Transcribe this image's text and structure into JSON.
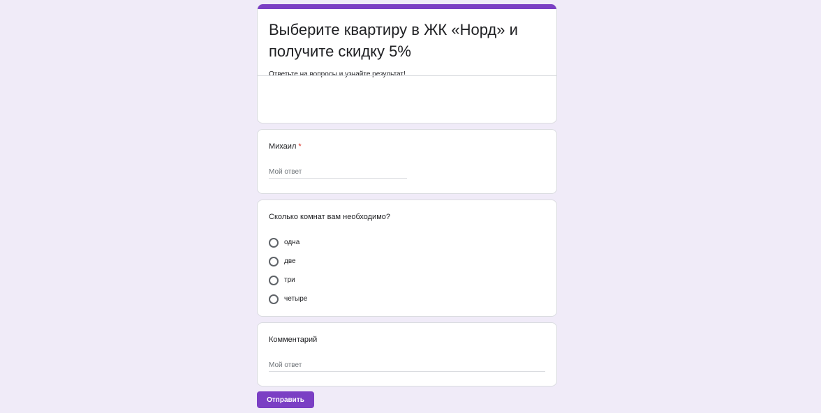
{
  "colors": {
    "background": "#f0ebf8",
    "accent": "#7b3fc4",
    "card": "#ffffff",
    "required": "#d93025"
  },
  "header": {
    "title": "Выберите квартиру в ЖК «Норд» и получите скидку 5%",
    "description": "Ответьте на вопросы и узнайте результат!"
  },
  "questions": {
    "name": {
      "label": "Михаил",
      "required_mark": "*",
      "placeholder": "Мой ответ"
    },
    "rooms": {
      "label": "Сколько комнат вам необходимо?",
      "options": [
        {
          "label": "одна",
          "icon": "radio-unchecked-icon"
        },
        {
          "label": "две",
          "icon": "radio-unchecked-icon"
        },
        {
          "label": "три",
          "icon": "radio-unchecked-icon"
        },
        {
          "label": "четыре",
          "icon": "radio-unchecked-icon"
        }
      ]
    },
    "comment": {
      "label": "Комментарий",
      "placeholder": "Мой ответ"
    }
  },
  "submit": {
    "label": "Отправить"
  }
}
